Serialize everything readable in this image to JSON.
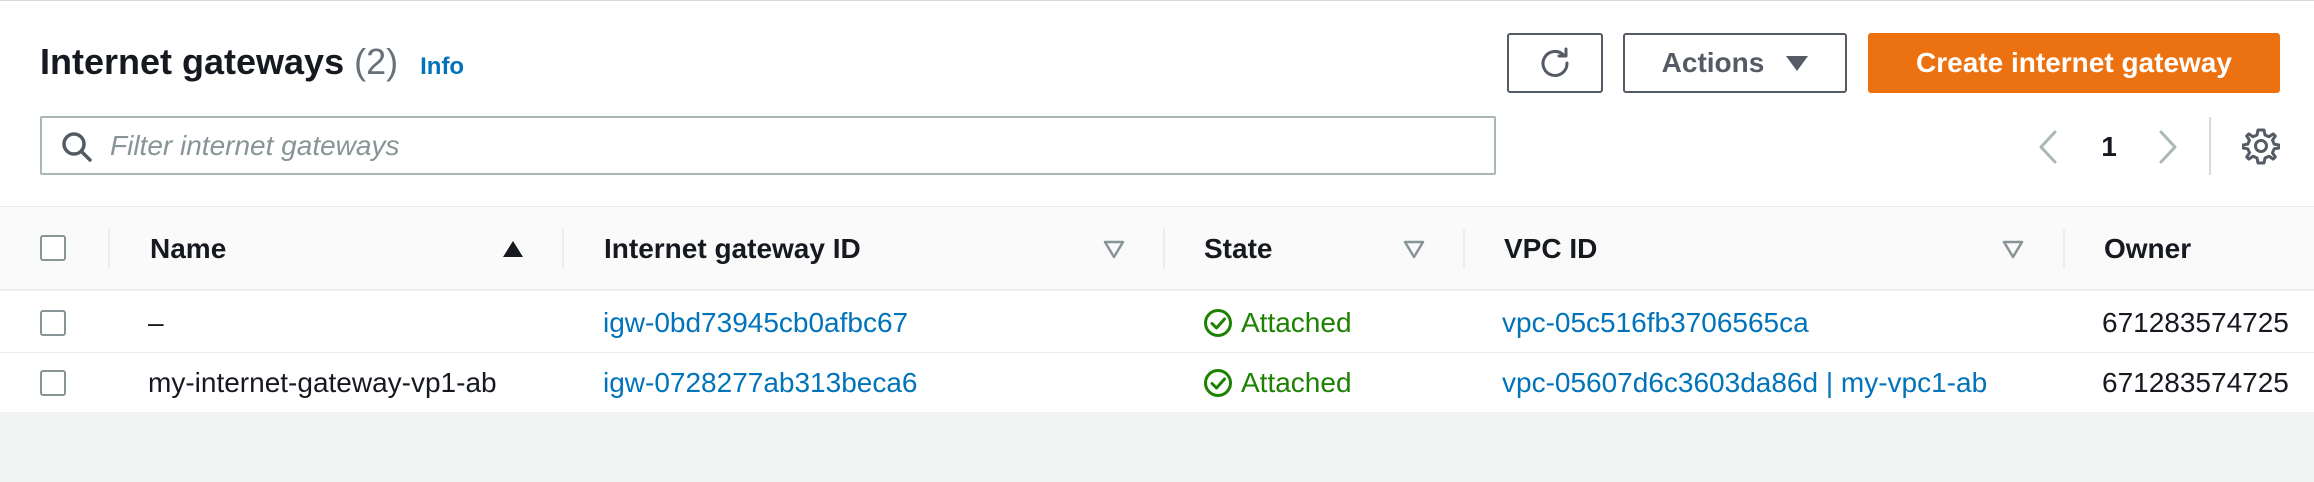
{
  "header": {
    "title": "Internet gateways",
    "count": "(2)",
    "info_label": "Info"
  },
  "toolbar": {
    "refresh_icon": "refresh-icon",
    "actions_label": "Actions",
    "create_label": "Create internet gateway"
  },
  "search": {
    "placeholder": "Filter internet gateways",
    "value": ""
  },
  "pagination": {
    "current_page": "1"
  },
  "table": {
    "columns": [
      {
        "label": "Name",
        "sort": "ascending"
      },
      {
        "label": "Internet gateway ID",
        "sort": "none"
      },
      {
        "label": "State",
        "sort": "none"
      },
      {
        "label": "VPC ID",
        "sort": "none"
      },
      {
        "label": "Owner",
        "sort": "none"
      }
    ],
    "rows": [
      {
        "name": "–",
        "gateway_id": "igw-0bd73945cb0afbc67",
        "state": "Attached",
        "vpc_id": "vpc-05c516fb3706565ca",
        "owner": "671283574725"
      },
      {
        "name": "my-internet-gateway-vp1-ab",
        "gateway_id": "igw-0728277ab313beca6",
        "state": "Attached",
        "vpc_id": "vpc-05607d6c3603da86d | my-vpc1-ab",
        "owner": "671283574725"
      }
    ]
  },
  "colors": {
    "primary_button": "#ec7211",
    "link": "#0073bb",
    "success": "#1d8102"
  }
}
